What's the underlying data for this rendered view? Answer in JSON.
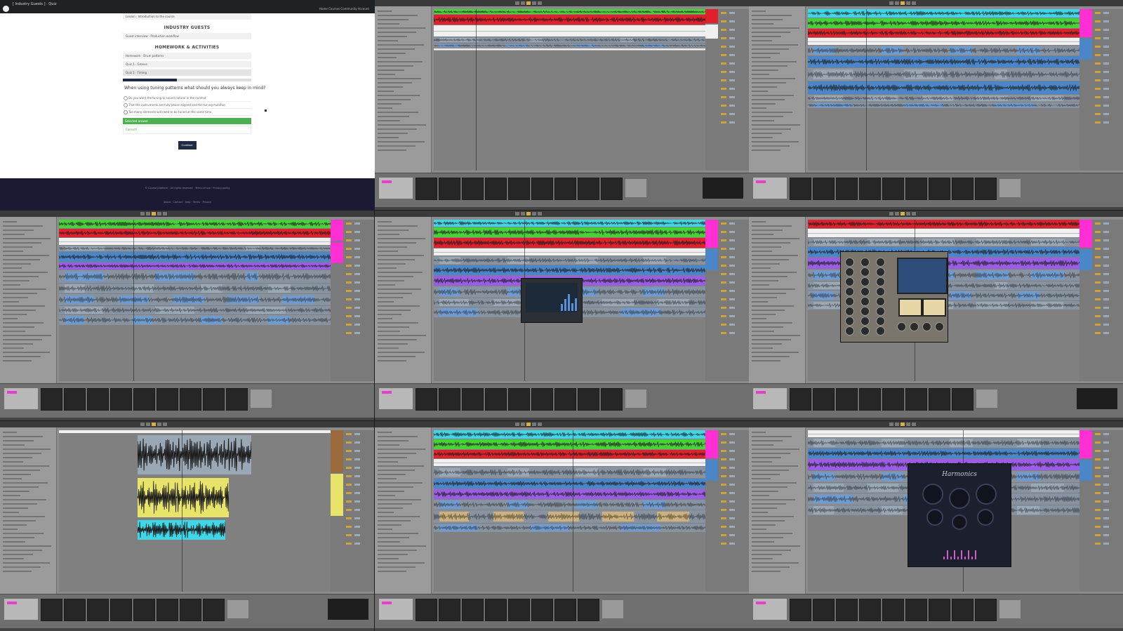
{
  "web": {
    "tab_text": "[ Industry Guests ] · Quiz",
    "nav_text": "Home  Courses  Community  Account",
    "items_top": [
      "Lesson · Introduction to the course"
    ],
    "section_guests": "INDUSTRY GUESTS",
    "items_guests": [
      "Guest interview · Production workflow"
    ],
    "section_homework": "HOMEWORK & ACTIVITIES",
    "items_homework": [
      "Homework · Drum patterns",
      "Quiz 1 · Groove",
      "Quiz 2 · Timing"
    ],
    "progress_fraction": 0.42,
    "question": "When using tuning patterns what should you always keep in mind?",
    "options": [
      "Do you want the tuning to sound natural in the context",
      "That the instruments are fully phase aligned and the tuning matches",
      "Too many elements will need to be tuned at the same time"
    ],
    "answer": "Selected answer",
    "result": "Correct!",
    "continue_label": "Continue",
    "footer_text": "© Course platform · All rights reserved · Terms of use · Privacy policy",
    "footer_links": "About  ·  Contact  ·  Help  ·  Terms  ·  Privacy"
  },
  "daw_colors": {
    "cyan": "#3fd7e8",
    "green": "#49d13a",
    "red": "#e0202a",
    "white": "#f0f0f0",
    "blue": "#4a86c8",
    "purple": "#9b5de5",
    "lightblue": "#6f9bd0",
    "pink": "#ff2fd3",
    "tan": "#cdb27e",
    "slate": "#9aa7b5",
    "yellow": "#e8e46a",
    "brown": "#9a6a3c"
  },
  "plugin_fx_title": "Harmonics"
}
